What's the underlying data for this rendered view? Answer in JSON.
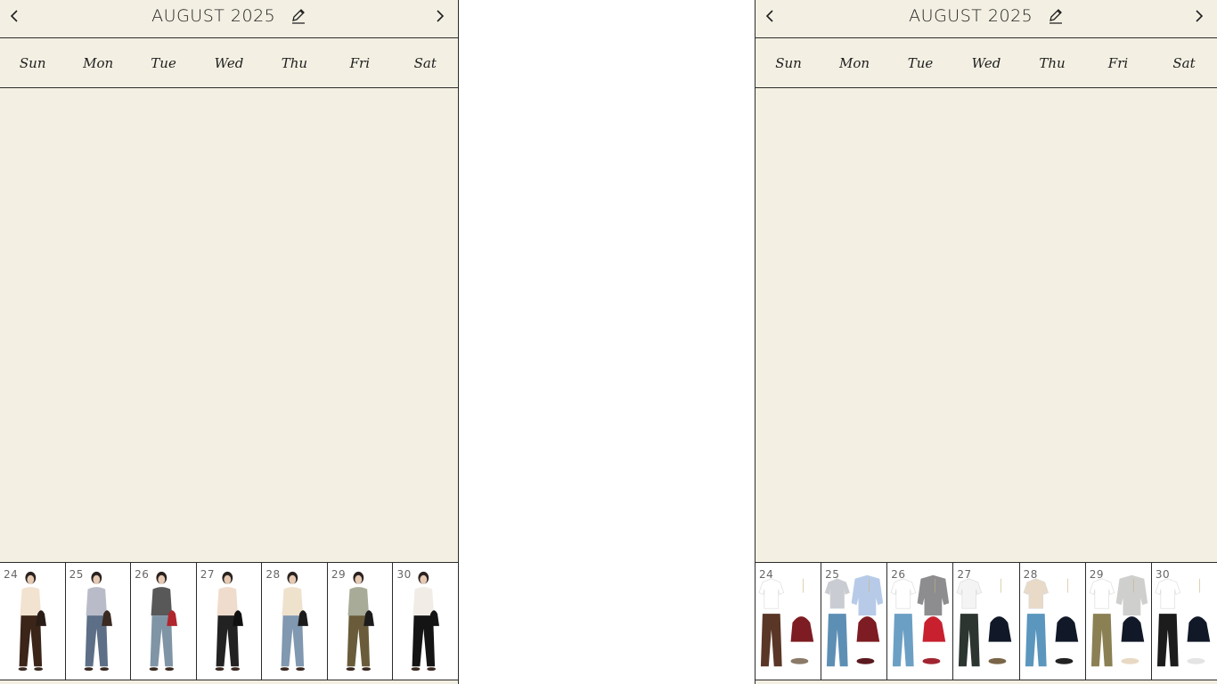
{
  "left": {
    "header": {
      "title": "AUGUST 2025"
    },
    "weekdays": [
      "Sun",
      "Mon",
      "Tue",
      "Wed",
      "Thu",
      "Fri",
      "Sat"
    ],
    "week": [
      {
        "day": "24",
        "top": "#f2e2d0",
        "bottom": "#3b2418",
        "bag": "#2a1c16"
      },
      {
        "day": "25",
        "top": "#b9bcc8",
        "bottom": "#5d6f86",
        "bag": "#3a2a22"
      },
      {
        "day": "26",
        "top": "#585858",
        "bottom": "#7f95a6",
        "bag": "#b0262c"
      },
      {
        "day": "27",
        "top": "#f0dccd",
        "bottom": "#222222",
        "bag": "#111111"
      },
      {
        "day": "28",
        "top": "#efe2cc",
        "bottom": "#8098b0",
        "bag": "#1c1c1c"
      },
      {
        "day": "29",
        "top": "#a7ab97",
        "bottom": "#6a5c3a",
        "bag": "#1c1c1c"
      },
      {
        "day": "30",
        "top": "#f1ede6",
        "bottom": "#141414",
        "bag": "#141414"
      }
    ]
  },
  "right": {
    "header": {
      "title": "AUGUST 2025"
    },
    "weekdays": [
      "Sun",
      "Mon",
      "Tue",
      "Wed",
      "Thu",
      "Fri",
      "Sat"
    ],
    "week": [
      {
        "day": "24",
        "top": "#ffffff",
        "bottom": "#5a3626",
        "bag": "#7d1c22",
        "shoe": "#8a7a68"
      },
      {
        "day": "25",
        "top": "#c9ccd2",
        "layer": "#b7cbe8",
        "bottom": "#5d8fb5",
        "bag": "#7d1c22",
        "shoe": "#5a1a1f"
      },
      {
        "day": "26",
        "top": "#ffffff",
        "layer": "#8d8d90",
        "bottom": "#6c9fc4",
        "bag": "#c8202f",
        "shoe": "#a12531"
      },
      {
        "day": "27",
        "top": "#f4f4f4",
        "bottom": "#2c3530",
        "bag": "#111827",
        "shoe": "#7a6548"
      },
      {
        "day": "28",
        "top": "#e9dac8",
        "bottom": "#5a96bd",
        "bag": "#111827",
        "shoe": "#222222"
      },
      {
        "day": "29",
        "top": "#ffffff",
        "layer": "#cfd0cd",
        "bottom": "#8a8054",
        "bag": "#111827",
        "shoe": "#e8d9c4"
      },
      {
        "day": "30",
        "top": "#ffffff",
        "bottom": "#1c1c1c",
        "bag": "#111827",
        "shoe": "#e4e4e4"
      }
    ]
  },
  "icons": {
    "prev": "chevron-left-icon",
    "next": "chevron-right-icon",
    "edit": "pencil-icon"
  }
}
